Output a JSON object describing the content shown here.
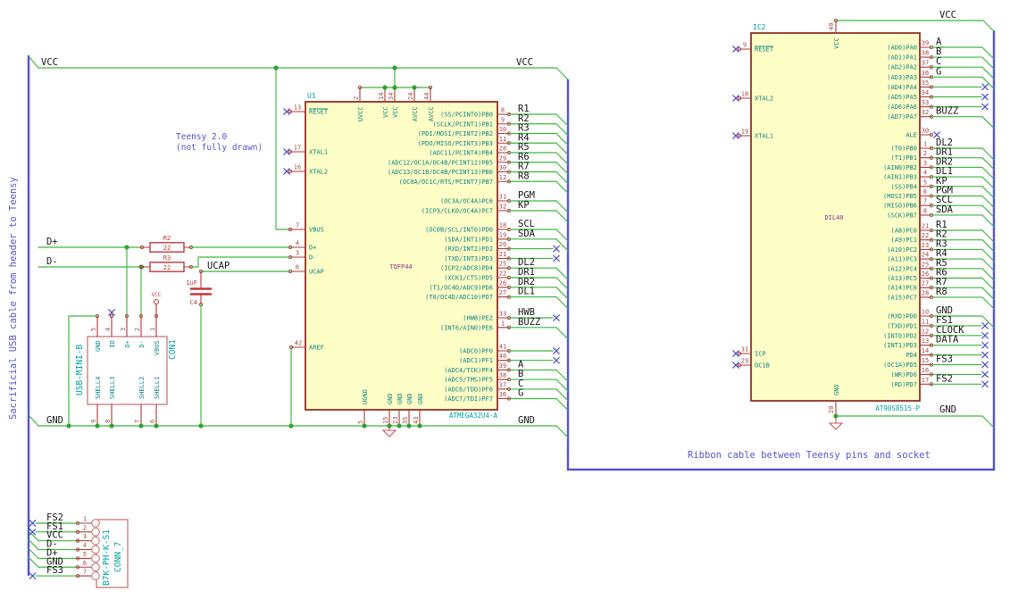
{
  "colors": {
    "wire": "#3db53d",
    "junction": "#2fa32f",
    "bus": "#5353d1",
    "note": "#5353d1",
    "pin": "#ab3a3a",
    "num": "#aa4545",
    "name": "#0e8484",
    "ref": "#00a2a2",
    "field": "#8d2f8d",
    "label": "#161616",
    "nc": "#4a4ace",
    "misc": "#c1393b",
    "conn": "#cf8080",
    "gndsym": "#c25a5a",
    "body_fill": "#fdfdc6",
    "body_stroke": "#8c231a"
  },
  "notes": {
    "cable": "Sacrificial USB cable from header to Teensy",
    "teensy1": "Teensy 2.0",
    "teensy2": "(not fully drawn)",
    "ribbon": "Ribbon cable between Teensy pins and socket"
  },
  "nets": {
    "vcc": "VCC",
    "gnd": "GND",
    "dp": "D+",
    "dm": "D-",
    "ucap": "UCAP"
  },
  "u1": {
    "ref": "U1",
    "value": "ATMEGA32U4-A",
    "field": "TQFP44",
    "left_pins": [
      {
        "num": "13",
        "name": "RESET",
        "term": "nc"
      },
      {
        "num": "17",
        "name": "XTAL1",
        "term": "nc"
      },
      {
        "num": "16",
        "name": "XTAL2",
        "term": "nc"
      },
      {
        "num": "7",
        "name": "VBUS",
        "term": "wired"
      },
      {
        "num": "4",
        "name": "D+",
        "term": "wired"
      },
      {
        "num": "3",
        "name": "D-",
        "term": "wired"
      },
      {
        "num": "6",
        "name": "UCAP",
        "term": "wired"
      },
      {
        "num": "42",
        "name": "AREF",
        "term": "wired"
      }
    ],
    "top_pins": [
      {
        "num": "2",
        "name": "UVCC"
      },
      {
        "num": "14",
        "name": "VCC"
      },
      {
        "num": "34",
        "name": "VCC"
      },
      {
        "num": "24",
        "name": "AVCC"
      },
      {
        "num": "44",
        "name": "AVCC"
      }
    ],
    "bottom_pins": [
      {
        "num": "5",
        "name": "UGND"
      },
      {
        "num": "15",
        "name": "GND"
      },
      {
        "num": "23",
        "name": "GND"
      },
      {
        "num": "35",
        "name": "GND"
      },
      {
        "num": "43",
        "name": "GND"
      }
    ],
    "right_pins": [
      {
        "num": "8",
        "name": "(SS/PCINT0)PB0",
        "label": "R1",
        "term": "bus"
      },
      {
        "num": "9",
        "name": "(SCLK/PCINT1)PB1",
        "label": "R2",
        "term": "bus"
      },
      {
        "num": "10",
        "name": "(PDI/MOSI/PCINT2)PB2",
        "label": "R3",
        "term": "bus"
      },
      {
        "num": "11",
        "name": "(PDO/MISO/PCINT3)PB3",
        "label": "R4",
        "term": "bus"
      },
      {
        "num": "28",
        "name": "(ADC11/PCINT4)PB4",
        "label": "R5",
        "term": "bus"
      },
      {
        "num": "29",
        "name": "(ADC12/OC1A/OC4B/PCINT12)PB5",
        "label": "R6",
        "term": "bus"
      },
      {
        "num": "30",
        "name": "(ADC13/OC1B/OC4B/PCINT13)PB6",
        "label": "R7",
        "term": "bus"
      },
      {
        "num": "12",
        "name": "(OC0A/OC1C/RTS/PCINT7)PB7",
        "label": "R8",
        "term": "bus"
      },
      {
        "num": "31",
        "name": "(OC3A/OC4A)PC6",
        "label": "PGM",
        "term": "bus"
      },
      {
        "num": "32",
        "name": "(ICP3/CLK0/OC4A)PC7",
        "label": "KP",
        "term": "bus"
      },
      {
        "num": "18",
        "name": "(OC0B/SCL/INT0)PD0",
        "label": "SCL",
        "term": "bus"
      },
      {
        "num": "19",
        "name": "(SDA/INT1)PD1",
        "label": "SDA",
        "term": "bus"
      },
      {
        "num": "20",
        "name": "(RXD/INT2)PD2",
        "label": "",
        "term": "nc"
      },
      {
        "num": "21",
        "name": "(TXD/INT3)PD3",
        "label": "",
        "term": "nc"
      },
      {
        "num": "25",
        "name": "(ICP2/ADC8)PD4",
        "label": "DL2",
        "term": "bus"
      },
      {
        "num": "22",
        "name": "(XCK1/CTS)PD5",
        "label": "DR1",
        "term": "bus"
      },
      {
        "num": "26",
        "name": "(T1/OC4D/ADC9)PD6",
        "label": "DR2",
        "term": "bus"
      },
      {
        "num": "27",
        "name": "(T0/OC4D/ADC10)PD7",
        "label": "DL1",
        "term": "bus"
      },
      {
        "num": "33",
        "name": "(HWB)PE2",
        "label": "HWB",
        "term": "nc"
      },
      {
        "num": "1",
        "name": "(INT6/AIN0)PE6",
        "label": "BUZZ",
        "term": "bus"
      },
      {
        "num": "41",
        "name": "(ADC0)PF0",
        "label": "",
        "term": "nc"
      },
      {
        "num": "40",
        "name": "(ADC1)PF1",
        "label": "",
        "term": "nc"
      },
      {
        "num": "39",
        "name": "(ADC4/TCK)PF4",
        "label": "A",
        "term": "bus"
      },
      {
        "num": "38",
        "name": "(ADC5/TMS)PF5",
        "label": "B",
        "term": "bus"
      },
      {
        "num": "37",
        "name": "(ADC6/TDO)PF6",
        "label": "C",
        "term": "bus"
      },
      {
        "num": "36",
        "name": "(ADC7/TDI)PF7",
        "label": "G",
        "term": "bus"
      }
    ]
  },
  "ic2": {
    "ref": "IC2",
    "value": "AT90S8515-P",
    "field": "DIL40",
    "top_pin": {
      "num": "40",
      "name": "VCC"
    },
    "bottom_pin": {
      "num": "20",
      "name": "GND"
    },
    "left_pins": [
      {
        "num": "9",
        "name": "RESET"
      },
      {
        "num": "18",
        "name": "XTAL2"
      },
      {
        "num": "19",
        "name": "XTAL1"
      },
      {
        "num": "31",
        "name": "ICP"
      },
      {
        "num": "29",
        "name": "OC1B"
      }
    ],
    "right_pins": [
      {
        "num": "39",
        "name": "(AD0)PA0",
        "label": "A",
        "term": "bus"
      },
      {
        "num": "38",
        "name": "(AD1)PA1",
        "label": "B",
        "term": "bus"
      },
      {
        "num": "37",
        "name": "(AD2)PA2",
        "label": "C",
        "term": "bus"
      },
      {
        "num": "36",
        "name": "(AD3)PA3",
        "label": "G",
        "term": "bus"
      },
      {
        "num": "35",
        "name": "(AD4)PA4",
        "label": "",
        "term": "nc"
      },
      {
        "num": "34",
        "name": "(AD5)PA5",
        "label": "",
        "term": "nc"
      },
      {
        "num": "33",
        "name": "(AD6)PA6",
        "label": "",
        "term": "nc"
      },
      {
        "num": "32",
        "name": "(AD7)PA7",
        "label": "BUZZ",
        "term": "bus"
      },
      {
        "num": "30",
        "name": "ALE",
        "label": "",
        "term": "ncshort"
      },
      {
        "num": "1",
        "name": "(T0)PB0",
        "label": "DL2",
        "term": "bus"
      },
      {
        "num": "2",
        "name": "(T1)PB1",
        "label": "DR1",
        "term": "bus"
      },
      {
        "num": "3",
        "name": "(AIN0)PB2",
        "label": "DR2",
        "term": "bus"
      },
      {
        "num": "4",
        "name": "(AIN1)PB3",
        "label": "DL1",
        "term": "bus"
      },
      {
        "num": "5",
        "name": "(SS)PB4",
        "label": "KP",
        "term": "bus"
      },
      {
        "num": "6",
        "name": "(MOSI)PB5",
        "label": "PGM",
        "term": "bus"
      },
      {
        "num": "7",
        "name": "(MISO)PB6",
        "label": "SCL",
        "term": "bus"
      },
      {
        "num": "8",
        "name": "(SCK)PB7",
        "label": "SDA",
        "term": "bus"
      },
      {
        "num": "21",
        "name": "(A8)PC0",
        "label": "R1",
        "term": "bus"
      },
      {
        "num": "22",
        "name": "(A9)PC1",
        "label": "R2",
        "term": "bus"
      },
      {
        "num": "23",
        "name": "(A10)PC2",
        "label": "R3",
        "term": "bus"
      },
      {
        "num": "24",
        "name": "(A11)PC3",
        "label": "R4",
        "term": "bus"
      },
      {
        "num": "25",
        "name": "(A12)PC4",
        "label": "R5",
        "term": "bus"
      },
      {
        "num": "26",
        "name": "(A13)PC5",
        "label": "R6",
        "term": "bus"
      },
      {
        "num": "27",
        "name": "(A14)PC6",
        "label": "R7",
        "term": "bus"
      },
      {
        "num": "28",
        "name": "(A15)PC7",
        "label": "R8",
        "term": "bus"
      },
      {
        "num": "10",
        "name": "(RXD)PD0",
        "label": "GND",
        "term": "bus"
      },
      {
        "num": "11",
        "name": "(TXD)PD1",
        "label": "FS1",
        "term": "nc"
      },
      {
        "num": "12",
        "name": "(INT0)PD2",
        "label": "CLOCK",
        "term": "nc"
      },
      {
        "num": "13",
        "name": "(INT1)PD3",
        "label": "DATA",
        "term": "nc"
      },
      {
        "num": "14",
        "name": "PD4",
        "label": "",
        "term": "nc"
      },
      {
        "num": "15",
        "name": "(OC1A)PD5",
        "label": "FS3",
        "term": "nc"
      },
      {
        "num": "16",
        "name": "(WR)PD6",
        "label": "",
        "term": "nc"
      },
      {
        "num": "17",
        "name": "(RD)PD7",
        "label": "FS2",
        "term": "nc"
      }
    ]
  },
  "con1": {
    "ref": "CON1",
    "value": "USB-MINI-B",
    "top_pins": [
      {
        "num": "5",
        "name": "GND"
      },
      {
        "num": "4",
        "name": "ID"
      },
      {
        "num": "3",
        "name": "D+"
      },
      {
        "num": "2",
        "name": "D-"
      },
      {
        "num": "1",
        "name": "VBUS"
      }
    ],
    "bottom_pins": [
      {
        "num": "9",
        "name": "SHELL4"
      },
      {
        "num": "8",
        "name": "SHELL3"
      },
      {
        "num": "7",
        "name": "SHELL2"
      },
      {
        "num": "6",
        "name": "SHELL1"
      }
    ]
  },
  "conn7": {
    "ref": "CONN_7",
    "value": "B7K-PH-K-S1",
    "pins": [
      {
        "num": "1",
        "label": "FS2",
        "term": "nc"
      },
      {
        "num": "2",
        "label": "FS1",
        "term": "nc"
      },
      {
        "num": "3",
        "label": "VCC",
        "term": "bus"
      },
      {
        "num": "4",
        "label": "D-",
        "term": "bus"
      },
      {
        "num": "5",
        "label": "D+",
        "term": "bus"
      },
      {
        "num": "6",
        "label": "GND",
        "term": "bus"
      },
      {
        "num": "7",
        "label": "FS3",
        "term": "nc"
      }
    ]
  },
  "r2": {
    "ref": "R2",
    "value": "22"
  },
  "r3": {
    "ref": "R3",
    "value": "22"
  },
  "c4": {
    "ref": "C4",
    "value": "1uF"
  }
}
